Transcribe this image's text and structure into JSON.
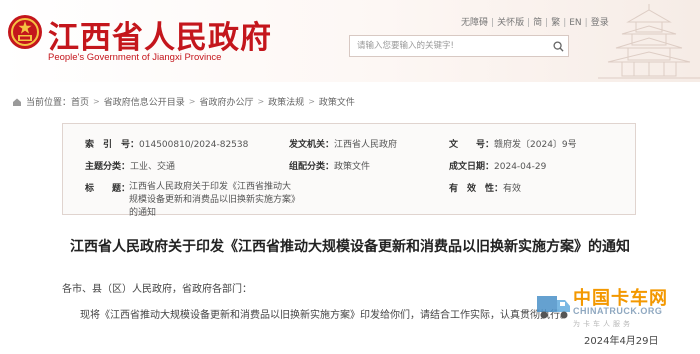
{
  "header": {
    "title": "江西省人民政府",
    "subtitle": "People's Government of Jiangxi Province",
    "links": [
      "无障碍",
      "关怀版",
      "简",
      "繁",
      "EN",
      "登录"
    ],
    "search_placeholder": "请输入您要输入的关键字!"
  },
  "breadcrumb": {
    "prefix": "当前位置：",
    "items": [
      "首页",
      "省政府信息公开目录",
      "省政府办公厅",
      "政策法规",
      "政策文件"
    ]
  },
  "info": {
    "index_key": "索　引　号：",
    "index_val": "014500810/2024-82538",
    "issuer_key": "发文机关：",
    "issuer_val": "江西省人民政府",
    "docno_key": "文　　号：",
    "docno_val": "赣府发〔2024〕9号",
    "topic_key": "主题分类：",
    "topic_val": "工业、交通",
    "genre_key": "组配分类：",
    "genre_val": "政策文件",
    "date_key": "成文日期：",
    "date_val": "2024-04-29",
    "title_key": "标　　题：",
    "title_val": "江西省人民政府关于印发《江西省推动大规模设备更新和消费品以旧换新实施方案》的通知",
    "validity_key": "有　效　性：",
    "validity_val": "有效"
  },
  "document": {
    "title": "江西省人民政府关于印发《江西省推动大规模设备更新和消费品以旧换新实施方案》的通知",
    "salutation": "各市、县（区）人民政府，省政府各部门：",
    "body": "现将《江西省推动大规模设备更新和消费品以旧换新实施方案》印发给你们，请结合工作实际，认真贯彻执行。",
    "date": "2024年4月29日"
  },
  "watermark": {
    "cn": "中国卡车网",
    "en": "CHINATRUCK.ORG",
    "tag": "为卡车人服务"
  },
  "colors": {
    "brand_red": "#c4161c",
    "watermark_orange": "#f39800"
  }
}
